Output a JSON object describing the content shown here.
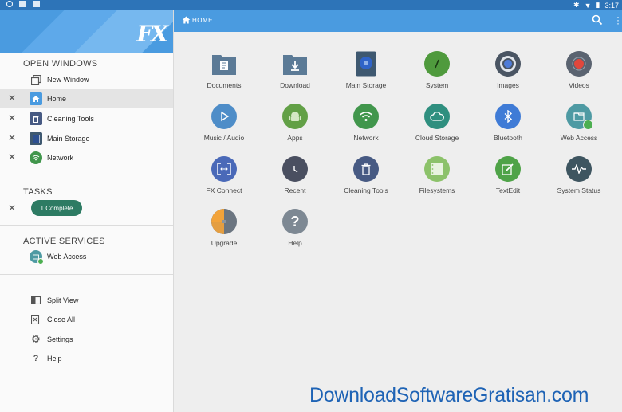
{
  "status_bar": {
    "time": "3:17"
  },
  "drawer": {
    "logo": "FX",
    "open_windows_title": "OPEN WINDOWS",
    "open_windows": [
      {
        "label": "New Window",
        "icon": "new-window-icon"
      },
      {
        "label": "Home",
        "icon": "home-icon",
        "active": true
      },
      {
        "label": "Cleaning Tools",
        "icon": "cleaning-tools-icon"
      },
      {
        "label": "Main Storage",
        "icon": "storage-icon"
      },
      {
        "label": "Network",
        "icon": "wifi-icon"
      }
    ],
    "tasks_title": "TASKS",
    "task_badge": "1 Complete",
    "active_services_title": "ACTIVE SERVICES",
    "active_services": [
      {
        "label": "Web Access",
        "icon": "web-access-icon"
      }
    ],
    "actions": [
      {
        "label": "Split View",
        "icon": "split-view-icon"
      },
      {
        "label": "Close All",
        "icon": "close-all-icon"
      },
      {
        "label": "Settings",
        "icon": "gear-icon"
      },
      {
        "label": "Help",
        "icon": "help-icon"
      }
    ]
  },
  "appbar": {
    "title": "HOME"
  },
  "grid": [
    {
      "label": "Documents",
      "icon": "documents-folder-icon",
      "color": "#5b7a96"
    },
    {
      "label": "Download",
      "icon": "download-folder-icon",
      "color": "#5b7a96"
    },
    {
      "label": "Main Storage",
      "icon": "main-storage-icon",
      "color": "#3e5870"
    },
    {
      "label": "System",
      "icon": "system-icon",
      "color": "#4f9a3d"
    },
    {
      "label": "Images",
      "icon": "images-icon",
      "color": "#4a5563"
    },
    {
      "label": "Videos",
      "icon": "videos-icon",
      "color": "#5a6370"
    },
    {
      "label": "Music / Audio",
      "icon": "music-icon",
      "color": "#4e8dc8"
    },
    {
      "label": "Apps",
      "icon": "android-icon",
      "color": "#62a046"
    },
    {
      "label": "Network",
      "icon": "network-icon",
      "color": "#41964c"
    },
    {
      "label": "Cloud Storage",
      "icon": "cloud-icon",
      "color": "#2f8f7f"
    },
    {
      "label": "Bluetooth",
      "icon": "bluetooth-icon",
      "color": "#3f7bd6"
    },
    {
      "label": "Web Access",
      "icon": "web-access-icon",
      "color": "#4e9aa3"
    },
    {
      "label": "FX Connect",
      "icon": "fx-connect-icon",
      "color": "#4a69b8"
    },
    {
      "label": "Recent",
      "icon": "clock-icon",
      "color": "#4a4f60"
    },
    {
      "label": "Cleaning Tools",
      "icon": "trash-icon",
      "color": "#475a83"
    },
    {
      "label": "Filesystems",
      "icon": "filesystems-icon",
      "color": "#8cc26a"
    },
    {
      "label": "TextEdit",
      "icon": "textedit-icon",
      "color": "#4fa348"
    },
    {
      "label": "System Status",
      "icon": "system-status-icon",
      "color": "#3e5560"
    },
    {
      "label": "Upgrade",
      "icon": "upgrade-icon",
      "color": "#f2a33a"
    },
    {
      "label": "Help",
      "icon": "help-icon",
      "color": "#7d8893"
    }
  ],
  "watermark": "DownloadSoftwareGratisan.com"
}
